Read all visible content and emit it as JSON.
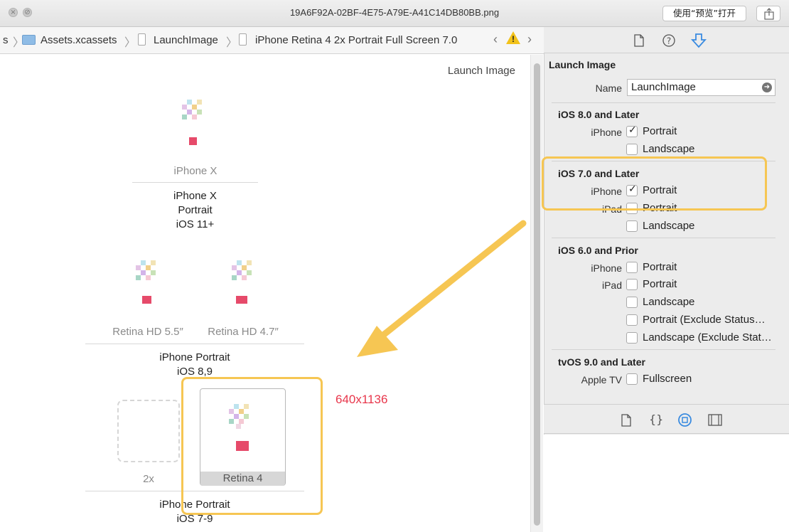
{
  "window": {
    "title": "19A6F92A-02BF-4E75-A79E-A41C14DB80BB.png",
    "open_button": "使用“预览”打开"
  },
  "jumpbar": {
    "crumbs": [
      "s",
      "Assets.xcassets",
      "LaunchImage",
      "iPhone Retina 4 2x Portrait Full Screen 7.0"
    ],
    "separator": "〉",
    "back": "‹",
    "forward": "›"
  },
  "canvas": {
    "header": "Launch Image",
    "slots": {
      "iphone_x": "iPhone X",
      "retina_hd_55": "Retina HD 5.5″",
      "retina_hd_47": "Retina HD 4.7″",
      "twox": "2x",
      "retina4": "Retina 4"
    },
    "groups": {
      "g1": [
        "iPhone X",
        "Portrait",
        "iOS 11+"
      ],
      "g2": [
        "iPhone Portrait",
        "iOS 8,9"
      ],
      "g3": [
        "iPhone Portrait",
        "iOS 7-9"
      ]
    },
    "dimension_note": "640x1136"
  },
  "inspector": {
    "tabs": [
      "file-icon",
      "help-icon",
      "attributes-icon"
    ],
    "section_title": "Launch Image",
    "name_label": "Name",
    "name_value": "LaunchImage",
    "ios8": {
      "title": "iOS 8.0 and Later",
      "iphone_label": "iPhone",
      "portrait": "Portrait",
      "landscape": "Landscape",
      "portrait_checked": true,
      "landscape_checked": false
    },
    "ios7": {
      "title": "iOS 7.0 and Later",
      "iphone_label": "iPhone",
      "ipad_label": "iPad",
      "iphone_portrait": "Portrait",
      "ipad_portrait": "Portrait",
      "ipad_landscape": "Landscape"
    },
    "ios6": {
      "title": "iOS 6.0 and Prior",
      "iphone_label": "iPhone",
      "ipad_label": "iPad",
      "iphone_portrait": "Portrait",
      "ipad_portrait": "Portrait",
      "ipad_landscape": "Landscape",
      "portrait_exclude": "Portrait (Exclude Status…",
      "landscape_exclude": "Landscape (Exclude Stat…"
    },
    "tvos": {
      "title": "tvOS 9.0 and Later",
      "appletv_label": "Apple TV",
      "fullscreen": "Fullscreen"
    }
  },
  "library": {
    "icons": [
      "file-template-icon",
      "code-snippet-icon",
      "object-icon",
      "media-icon"
    ]
  },
  "colors": {
    "highlight": "#f6c653",
    "dimension_text": "#e8364b",
    "arrow": "#f6c653"
  }
}
